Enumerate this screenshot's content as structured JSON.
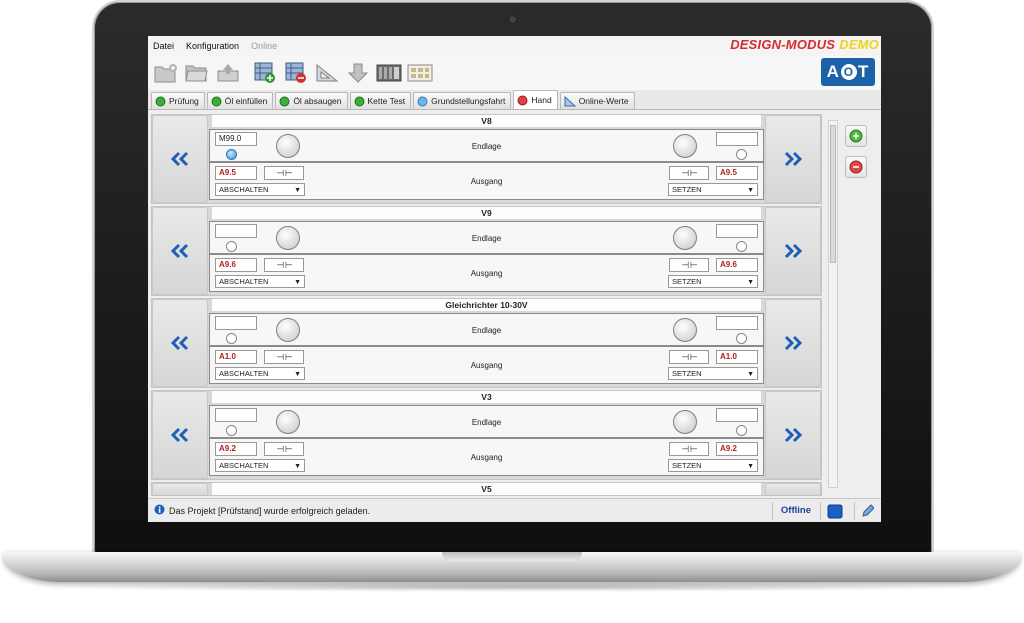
{
  "menu": {
    "items": [
      "Datei",
      "Konfiguration",
      "Online"
    ],
    "mode_label": "DESIGN-MODUS",
    "demo_label": "DEMO"
  },
  "logo": {
    "text_a": "A",
    "text_o": "O",
    "text_t": "T"
  },
  "toolbar": {
    "buttons": [
      "new-project-icon",
      "open-folder-icon",
      "save-icon",
      "add-row-icon",
      "remove-row-icon",
      "triangle-ruler-icon",
      "download-arrow-icon",
      "plc-module-icon",
      "grid-panel-icon"
    ]
  },
  "tabs": [
    {
      "label": "Prüfung",
      "led": "green"
    },
    {
      "label": "Öl einfüllen",
      "led": "green"
    },
    {
      "label": "Öl absaugen",
      "led": "green"
    },
    {
      "label": "Kette Test",
      "led": "green"
    },
    {
      "label": "Grundstellungsfahrt",
      "led": "blue"
    },
    {
      "label": "Hand",
      "led": "red",
      "active": true
    },
    {
      "label": "Online-Werte",
      "led": "triangle"
    }
  ],
  "panels": [
    {
      "title": "V8",
      "top_label": "Endlage",
      "bottom_label": "Ausgang",
      "left_input": "M99.0",
      "left_led_active": true,
      "right_input": "",
      "left_addr": "A9.5",
      "right_addr": "A9.5",
      "left_select": "ABSCHALTEN",
      "right_select": "SETZEN"
    },
    {
      "title": "V9",
      "top_label": "Endlage",
      "bottom_label": "Ausgang",
      "left_input": "",
      "left_led_active": false,
      "right_input": "",
      "left_addr": "A9.6",
      "right_addr": "A9.6",
      "left_select": "ABSCHALTEN",
      "right_select": "SETZEN"
    },
    {
      "title": "Gleichrichter 10-30V",
      "top_label": "Endlage",
      "bottom_label": "Ausgang",
      "left_input": "",
      "left_led_active": false,
      "right_input": "",
      "left_addr": "A1.0",
      "right_addr": "A1.0",
      "left_select": "ABSCHALTEN",
      "right_select": "SETZEN"
    },
    {
      "title": "V3",
      "top_label": "Endlage",
      "bottom_label": "Ausgang",
      "left_input": "",
      "left_led_active": false,
      "right_input": "",
      "left_addr": "A9.2",
      "right_addr": "A9.2",
      "left_select": "ABSCHALTEN",
      "right_select": "SETZEN"
    },
    {
      "title": "V5"
    }
  ],
  "contact_symbol": "⊣ ⊢",
  "status": {
    "message": "Das Projekt [Prüfstand] wurde erfolgreich geladen.",
    "connection": "Offline"
  },
  "colors": {
    "accent_blue": "#1b62a8",
    "design_mode_red": "#d62b2b",
    "demo_yellow": "#f0d21a",
    "address_red": "#b02121"
  }
}
